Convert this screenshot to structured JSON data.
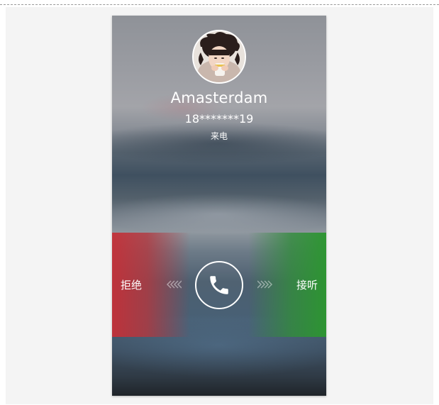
{
  "caller": {
    "name": "Amasterdam",
    "number": "18*******19",
    "status": "来电"
  },
  "actions": {
    "decline_label": "拒绝",
    "answer_label": "接听"
  },
  "icons": {
    "avatar": "avatar-photo",
    "call": "phone-icon",
    "left_arrows": "chevrons-left-icon",
    "right_arrows": "chevrons-right-icon"
  },
  "colors": {
    "decline": "#c43038",
    "answer": "#2c9630",
    "text": "#ffffff"
  }
}
